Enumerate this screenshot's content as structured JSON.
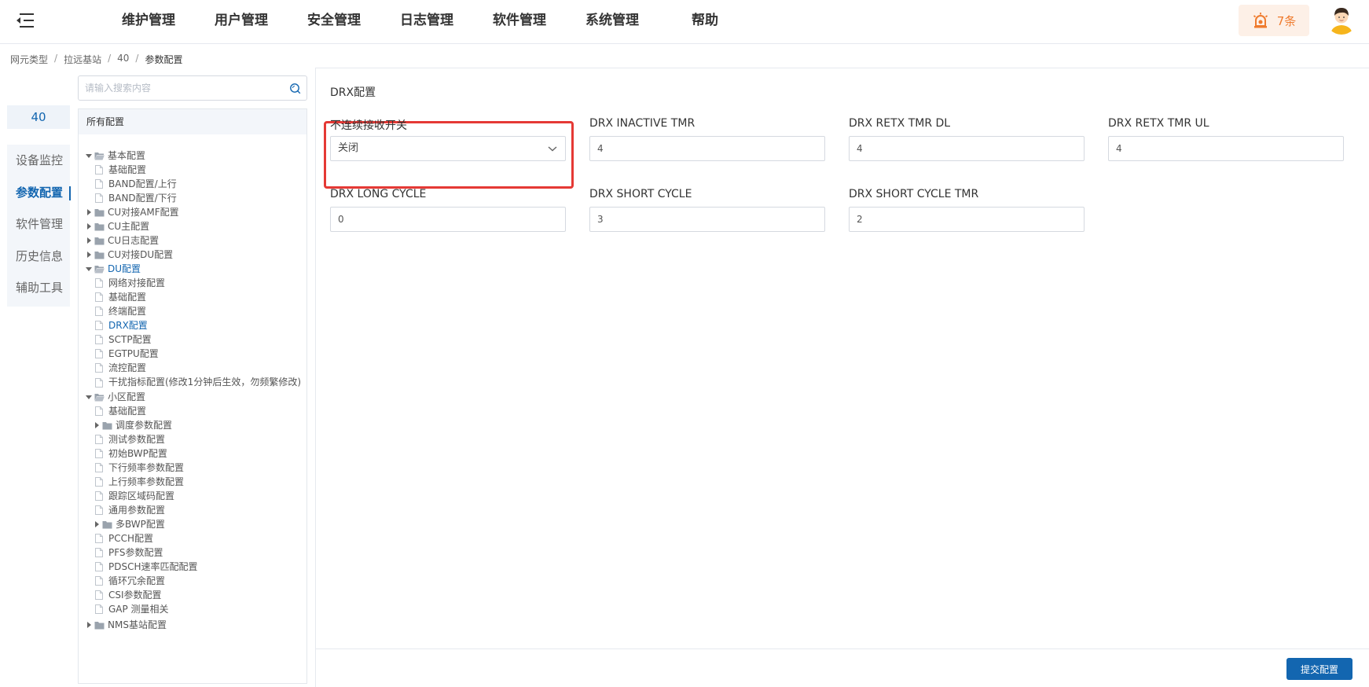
{
  "header": {
    "nav": [
      "维护管理",
      "用户管理",
      "安全管理",
      "日志管理",
      "软件管理",
      "系统管理",
      "帮助"
    ],
    "alarm_count": "7条"
  },
  "breadcrumb": [
    "网元类型",
    "拉远基站",
    "40",
    "参数配置"
  ],
  "sidebar": {
    "node": "40",
    "items": [
      "设备监控",
      "参数配置",
      "软件管理",
      "历史信息",
      "辅助工具"
    ]
  },
  "tree": {
    "search_placeholder": "请输入搜索内容",
    "title": "所有配置",
    "nodes": [
      {
        "label": "基本配置",
        "type": "folder",
        "level": 0,
        "expanded": true
      },
      {
        "label": "基础配置",
        "type": "file",
        "level": 1
      },
      {
        "label": "BAND配置/上行",
        "type": "file",
        "level": 1
      },
      {
        "label": "BAND配置/下行",
        "type": "file",
        "level": 1
      },
      {
        "label": "CU对接AMF配置",
        "type": "folder",
        "level": 0,
        "expanded": false
      },
      {
        "label": "CU主配置",
        "type": "folder",
        "level": 0,
        "expanded": false
      },
      {
        "label": "CU日志配置",
        "type": "folder",
        "level": 0,
        "expanded": false
      },
      {
        "label": "CU对接DU配置",
        "type": "folder",
        "level": 0,
        "expanded": false
      },
      {
        "label": "DU配置",
        "type": "folder",
        "level": 0,
        "expanded": true,
        "selected": true
      },
      {
        "label": "网络对接配置",
        "type": "file",
        "level": 1
      },
      {
        "label": "基础配置",
        "type": "file",
        "level": 1
      },
      {
        "label": "终端配置",
        "type": "file",
        "level": 1
      },
      {
        "label": "DRX配置",
        "type": "file",
        "level": 1,
        "selected": true
      },
      {
        "label": "SCTP配置",
        "type": "file",
        "level": 1
      },
      {
        "label": "EGTPU配置",
        "type": "file",
        "level": 1
      },
      {
        "label": "流控配置",
        "type": "file",
        "level": 1
      },
      {
        "label": "干扰指标配置(修改1分钟后生效，勿频繁修改)",
        "type": "file",
        "level": 1,
        "multiline": true
      },
      {
        "label": "小区配置",
        "type": "folder",
        "level": 0,
        "expanded": true
      },
      {
        "label": "基础配置",
        "type": "file",
        "level": 1
      },
      {
        "label": "调度参数配置",
        "type": "folder",
        "level": 1,
        "expanded": false
      },
      {
        "label": "测试参数配置",
        "type": "file",
        "level": 1
      },
      {
        "label": "初始BWP配置",
        "type": "file",
        "level": 1
      },
      {
        "label": "下行频率参数配置",
        "type": "file",
        "level": 1
      },
      {
        "label": "上行频率参数配置",
        "type": "file",
        "level": 1
      },
      {
        "label": "跟踪区域码配置",
        "type": "file",
        "level": 1
      },
      {
        "label": "通用参数配置",
        "type": "file",
        "level": 1
      },
      {
        "label": "多BWP配置",
        "type": "folder",
        "level": 1,
        "expanded": false
      },
      {
        "label": "PCCH配置",
        "type": "file",
        "level": 1
      },
      {
        "label": "PFS参数配置",
        "type": "file",
        "level": 1
      },
      {
        "label": "PDSCH速率匹配配置",
        "type": "file",
        "level": 1
      },
      {
        "label": "循环冗余配置",
        "type": "file",
        "level": 1
      },
      {
        "label": "CSI参数配置",
        "type": "file",
        "level": 1
      },
      {
        "label": "GAP 测量相关",
        "type": "file",
        "level": 1
      },
      {
        "label": "NMS基站配置",
        "type": "folder",
        "level": 0,
        "expanded": false,
        "gap_before": true
      }
    ]
  },
  "content": {
    "title": "DRX配置",
    "fields": [
      {
        "label": "不连续接收开关",
        "value": "关闭",
        "kind": "select"
      },
      {
        "label": "DRX INACTIVE TMR",
        "value": "4",
        "kind": "input"
      },
      {
        "label": "DRX RETX TMR DL",
        "value": "4",
        "kind": "input"
      },
      {
        "label": "DRX RETX TMR UL",
        "value": "4",
        "kind": "input"
      },
      {
        "label": "DRX LONG CYCLE",
        "value": "0",
        "kind": "input"
      },
      {
        "label": "DRX SHORT CYCLE",
        "value": "3",
        "kind": "input"
      },
      {
        "label": "DRX SHORT CYCLE TMR",
        "value": "2",
        "kind": "input"
      }
    ],
    "submit_label": "提交配置"
  },
  "colors": {
    "accent": "#1366b0",
    "highlight": "#e53935",
    "alarm": "#ef7b2e"
  }
}
